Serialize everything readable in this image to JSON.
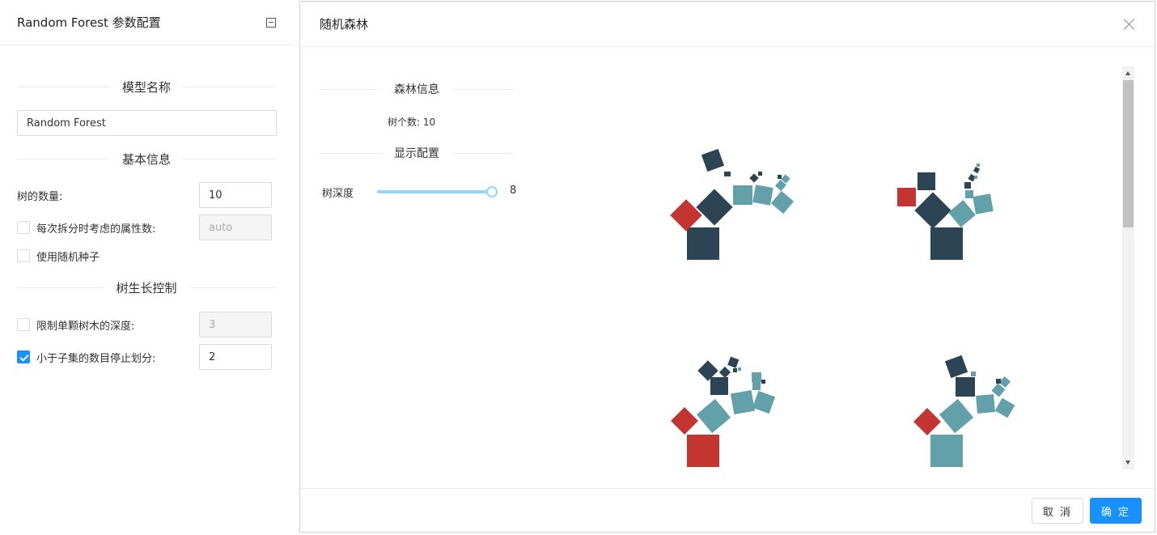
{
  "left_panel": {
    "title": "Random Forest 参数配置",
    "sections": {
      "model_name": "模型名称",
      "basic_info": "基本信息",
      "growth_control": "树生长控制"
    },
    "model_name_value": "Random Forest",
    "num_trees_label": "树的数量:",
    "num_trees_value": "10",
    "features_per_split_label": "每次拆分时考虑的属性数:",
    "features_per_split_value": "auto",
    "random_seed_label": "使用随机种子",
    "max_depth_label": "限制单颗树木的深度:",
    "max_depth_value": "3",
    "min_split_label": "小于子集的数目停止划分:",
    "min_split_value": "2"
  },
  "modal": {
    "title": "随机森林",
    "forest_info_heading": "森林信息",
    "tree_count_text": "树个数: 10",
    "display_config_heading": "显示配置",
    "tree_depth_label": "树深度",
    "tree_depth_value": "8",
    "tree_depth_fraction": 1.0,
    "cancel_label": "取 消",
    "ok_label": "确 定"
  },
  "colors": {
    "dark": "#2c4454",
    "teal": "#62a0aa",
    "red": "#c23531",
    "accent": "#1890ff"
  }
}
